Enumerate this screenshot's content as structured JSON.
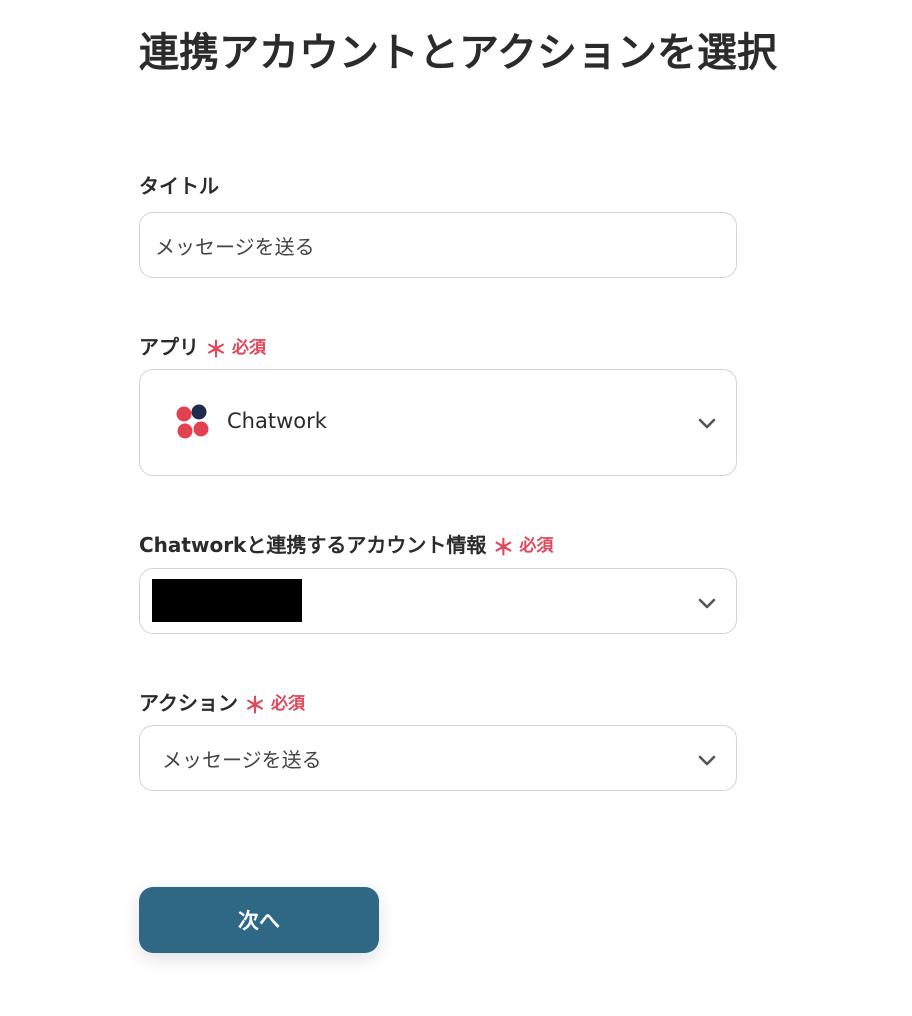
{
  "header": {
    "title": "連携アカウントとアクションを選択"
  },
  "form": {
    "title_field": {
      "label": "タイトル",
      "value": "メッセージを送る"
    },
    "app_field": {
      "label": "アプリ",
      "required_mark": "＊",
      "required_text": "必須",
      "selected_app": "Chatwork",
      "app_icon": "chatwork-logo"
    },
    "account_field": {
      "label": "Chatworkと連携するアカウント情報",
      "required_mark": "＊",
      "required_text": "必須"
    },
    "action_field": {
      "label": "アクション",
      "required_mark": "＊",
      "required_text": "必須",
      "value": "メッセージを送る"
    }
  },
  "footer": {
    "next_label": "次へ"
  },
  "colors": {
    "required": "#e0485b",
    "primary_button": "#2e6884",
    "logo_red": "#e2414f",
    "logo_navy": "#1d2b4c"
  }
}
